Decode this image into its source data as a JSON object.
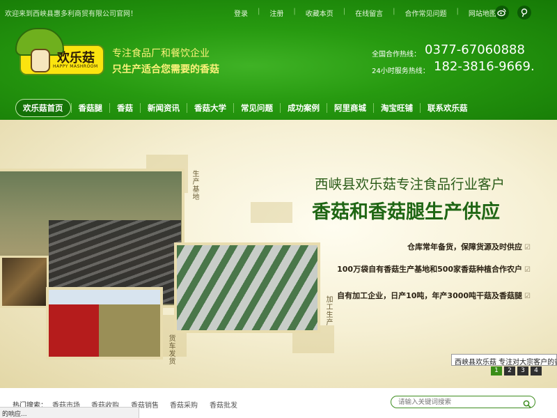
{
  "header": {
    "welcome": "欢迎来到西峡县惠多利商贸有限公司官网！",
    "top_links": [
      "登录",
      "注册",
      "收藏本页",
      "在线留言",
      "合作常见问题",
      "网站地图"
    ],
    "social": [
      "weibo-icon",
      "qq-icon"
    ],
    "logo": {
      "text": "欢乐菇",
      "sub": "HAPPY MASHROOM"
    },
    "slogan_line1": "专注食品厂和餐饮企业",
    "slogan_line2": "只生产适合您需要的香菇",
    "hotline1_label": "全国合作热线：",
    "hotline1_number": "0377-67060888",
    "hotline2_label": "24小时服务热线：",
    "hotline2_number": "182-3816-9669."
  },
  "nav": {
    "items": [
      "欢乐菇首页",
      "香菇腿",
      "香菇",
      "新闻资讯",
      "香菇大学",
      "常见问题",
      "成功案例",
      "阿里商城",
      "淘宝旺铺",
      "联系欢乐菇"
    ],
    "active_index": 0
  },
  "banner": {
    "title1": "西峡县欢乐菇专注食品行业客户",
    "title2": "香菇和香菇腿生产供应",
    "lines": [
      "仓库常年备货，保障货源及时供应",
      "100万袋自有香菇生产基地和500家香菇种植合作农户",
      "自有加工企业，日产10吨，年产3000吨干菇及香菇腿"
    ],
    "photo_labels": [
      "生产基地",
      "加工生产",
      "货车发货"
    ],
    "caption": "西峡县欢乐菇  专注对大宗客户的香菇",
    "pager": [
      "1",
      "2",
      "3",
      "4"
    ],
    "active_page": 0
  },
  "bottom": {
    "hot_label": "热门搜索：",
    "hot_links": [
      "香菇市场",
      "香菇收购",
      "香菇销售",
      "香菇采购",
      "香菇批发"
    ],
    "search_placeholder": "请输入关键词搜索",
    "status_text": "的响应..."
  },
  "colors": {
    "brand_green": "#279a10",
    "accent_yellow": "#fcf27a",
    "banner_green": "#1f6614"
  }
}
